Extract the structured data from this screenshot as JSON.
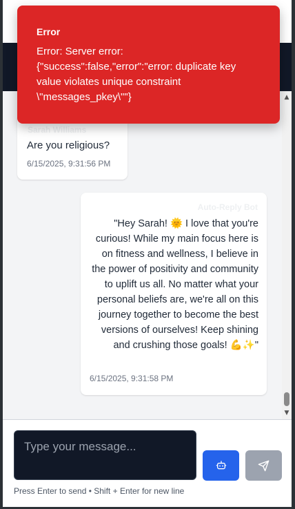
{
  "toast": {
    "title": "Error",
    "message": "Error: Server error: {\"success\":false,\"error\":\"error: duplicate key value violates unique constraint \\\"messages_pkey\\\"\"}"
  },
  "messages": [
    {
      "sender": "Sarah Williams",
      "text": "Are you religious?",
      "time": "6/15/2025, 9:31:56 PM",
      "side": "left"
    },
    {
      "sender": "Auto-Reply Bot",
      "text": "\"Hey Sarah! 🌞 I love that you're curious! While my main focus here is on fitness and wellness, I believe in the power of positivity and community to uplift us all. No matter what your personal beliefs are, we're all on this journey together to become the best versions of ourselves! Keep shining and crushing those goals! 💪✨\"",
      "time": "6/15/2025, 9:31:58 PM",
      "side": "right"
    }
  ],
  "composer": {
    "placeholder": "Type your message...",
    "hint": "Press Enter to send • Shift + Enter for new line",
    "bot_icon": "bot-icon",
    "send_icon": "send-icon"
  },
  "colors": {
    "error": "#dc2626",
    "primary": "#2563eb",
    "disabled": "#9ca3af",
    "header": "#111827"
  }
}
